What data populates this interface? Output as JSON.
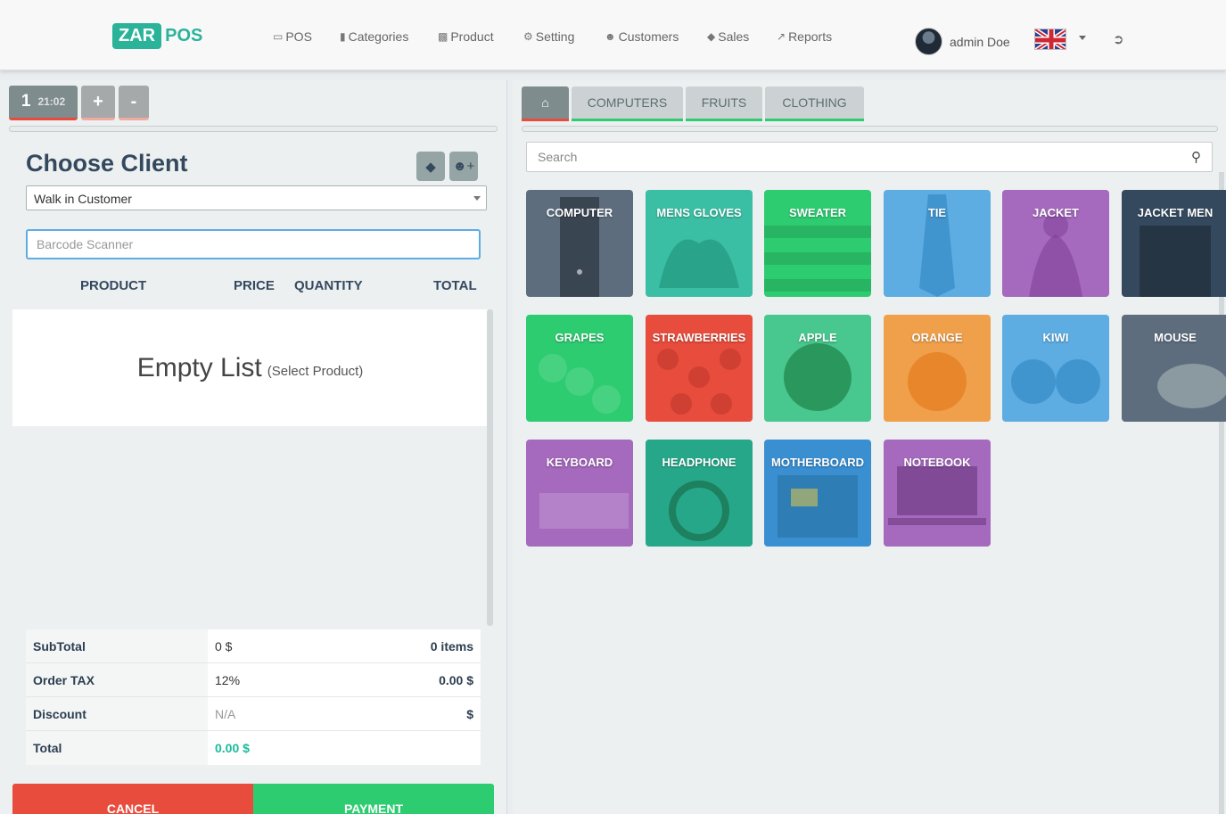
{
  "brand": {
    "part1": "ZAR",
    "part2": "POS"
  },
  "nav": [
    {
      "label": "POS",
      "icon": "credit-card-icon"
    },
    {
      "label": "Categories",
      "icon": "bookmark-icon"
    },
    {
      "label": "Product",
      "icon": "archive-icon"
    },
    {
      "label": "Setting",
      "icon": "cogs-icon"
    },
    {
      "label": "Customers",
      "icon": "users-icon"
    },
    {
      "label": "Sales",
      "icon": "ticket-icon"
    },
    {
      "label": "Reports",
      "icon": "line-chart-icon"
    }
  ],
  "user": {
    "name": "admin Doe"
  },
  "order_tabs": {
    "number": "1",
    "time": "21:02",
    "add": "+",
    "remove": "-"
  },
  "client": {
    "title": "Choose Client",
    "selected": "Walk in Customer",
    "barcode_placeholder": "Barcode Scanner"
  },
  "table_headers": {
    "product": "PRODUCT",
    "price": "PRICE",
    "quantity": "QUANTITY",
    "total": "TOTAL"
  },
  "empty_list": {
    "main": "Empty List",
    "hint": "(Select Product)"
  },
  "totals": {
    "subtotal": {
      "label": "SubTotal",
      "value": "0 $",
      "extra": "0 items"
    },
    "tax": {
      "label": "Order TAX",
      "value": "12%",
      "extra": "0.00 $"
    },
    "discount": {
      "label": "Discount",
      "value": "N/A",
      "extra": "$"
    },
    "total": {
      "label": "Total",
      "value": "0.00 $"
    }
  },
  "actions": {
    "cancel": "CANCEL",
    "payment": "PAYMENT"
  },
  "categories": [
    "COMPUTERS",
    "FRUITS",
    "CLOTHING"
  ],
  "search_placeholder": "Search",
  "products": [
    {
      "name": "COMPUTER",
      "color": "#5d6d7e"
    },
    {
      "name": "MENS GLOVES",
      "color": "#3bbfa4"
    },
    {
      "name": "SWEATER",
      "color": "#2ecc71"
    },
    {
      "name": "TIE",
      "color": "#5dade2"
    },
    {
      "name": "JACKET",
      "color": "#a569bd"
    },
    {
      "name": "JACKET MEN",
      "color": "#34495e"
    },
    {
      "name": "GRAPES",
      "color": "#2ecc71"
    },
    {
      "name": "STRAWBERRIES",
      "color": "#e74c3c"
    },
    {
      "name": "APPLE",
      "color": "#48c78e"
    },
    {
      "name": "ORANGE",
      "color": "#f0a04b"
    },
    {
      "name": "KIWI",
      "color": "#5dade2"
    },
    {
      "name": "MOUSE",
      "color": "#5d6d7e"
    },
    {
      "name": "KEYBOARD",
      "color": "#a569bd"
    },
    {
      "name": "HEADPHONE",
      "color": "#27a78a"
    },
    {
      "name": "MOTHERBOARD",
      "color": "#3a8fd1"
    },
    {
      "name": "NOTEBOOK",
      "color": "#a569bd"
    }
  ]
}
